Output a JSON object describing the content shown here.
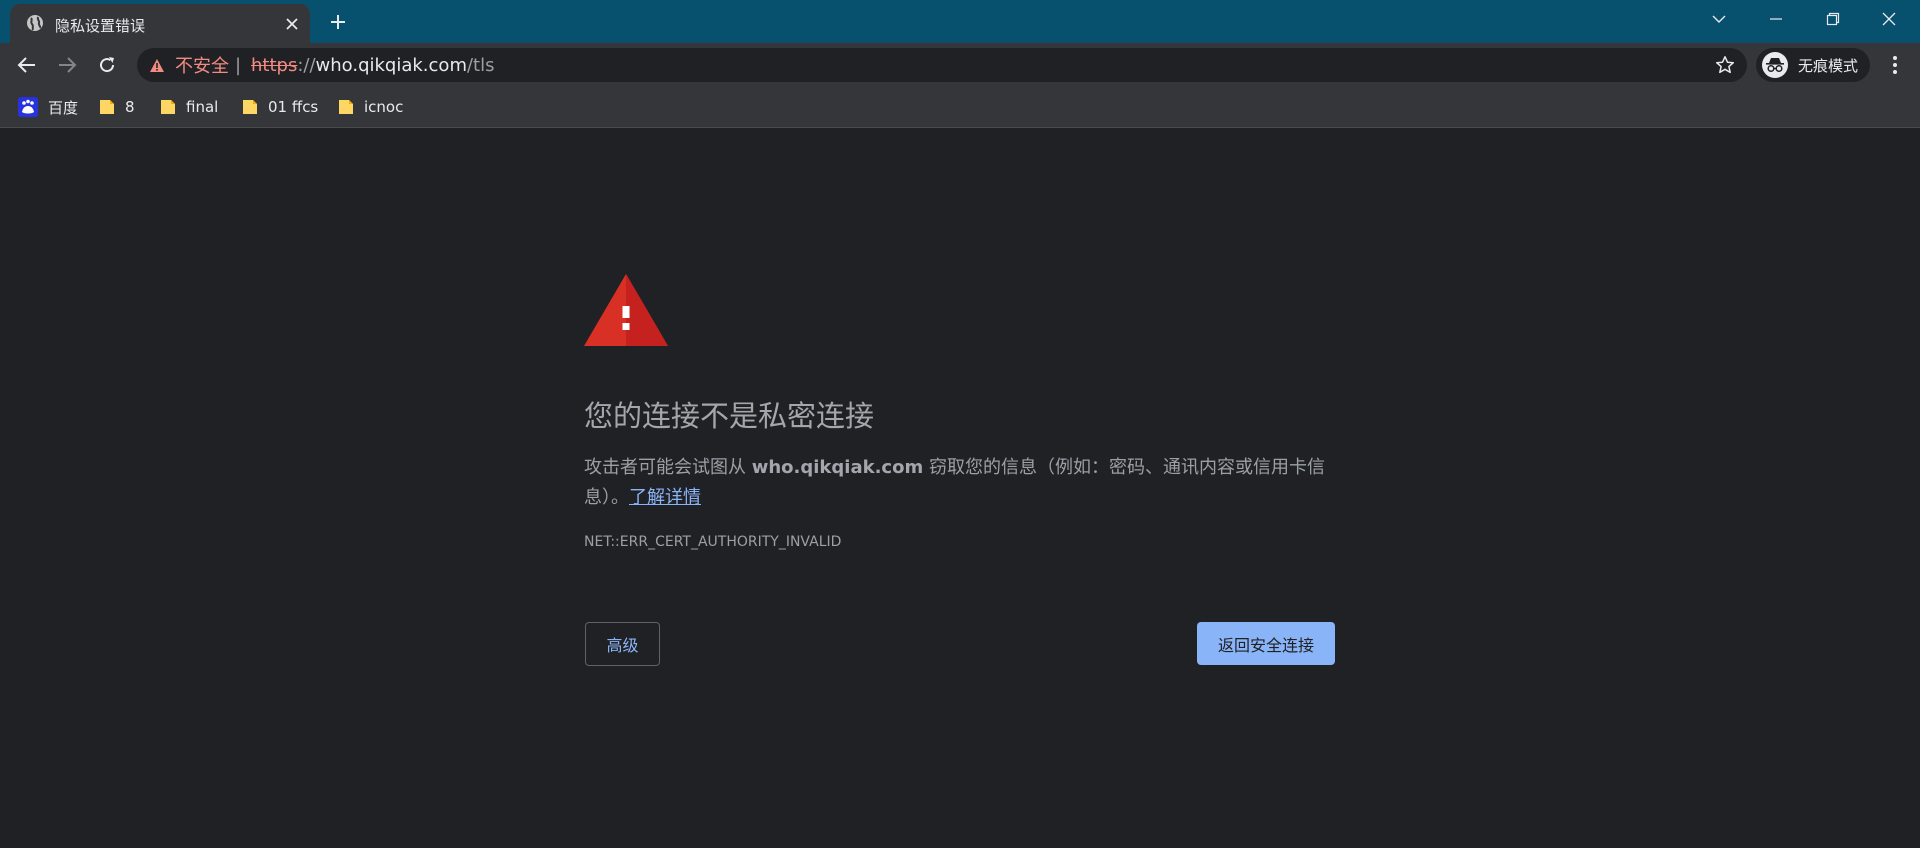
{
  "tab": {
    "title": "隐私设置错误",
    "favicon": "globe-icon",
    "close_icon": "close-icon"
  },
  "window_controls": {
    "icons": [
      "chevron-down-icon",
      "minimize-icon",
      "restore-icon",
      "close-icon"
    ]
  },
  "toolbar": {
    "security_label": "不安全",
    "url": {
      "scheme": "https",
      "separator": "://",
      "host": "who.qikqiak.com",
      "path": "/tls"
    },
    "incognito_label": "无痕模式"
  },
  "bookmarks": [
    {
      "label": "百度",
      "icon": "baidu-icon"
    },
    {
      "label": "8",
      "icon": "folder-icon"
    },
    {
      "label": "final",
      "icon": "folder-icon"
    },
    {
      "label": "01 ffcs",
      "icon": "folder-icon"
    },
    {
      "label": "icnoc",
      "icon": "folder-icon"
    }
  ],
  "interstitial": {
    "headline": "您的连接不是私密连接",
    "explanation_prefix": "攻击者可能会试图从 ",
    "explanation_host": "who.qikqiak.com",
    "explanation_suffix": " 窃取您的信息（例如：密码、通讯内容或信用卡信息）。",
    "learn_more": "了解详情",
    "error_code": "NET::ERR_CERT_AUTHORITY_INVALID",
    "advanced_button": "高级",
    "back_button": "返回安全连接"
  },
  "colors": {
    "titlebar": "#07516f",
    "toolbar": "#35363a",
    "page_background": "#202124",
    "warning_red": "#d93025",
    "insecure_text": "#f28b82",
    "link_blue": "#8ab4f8"
  }
}
